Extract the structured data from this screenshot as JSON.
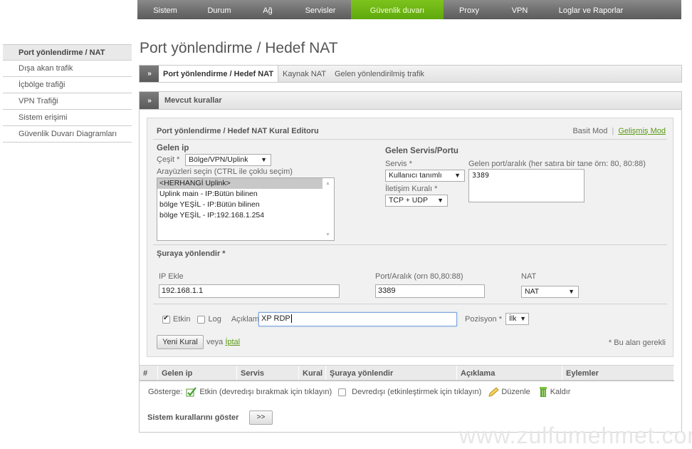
{
  "topnav": {
    "items": [
      {
        "label": "Sistem",
        "active": false
      },
      {
        "label": "Durum",
        "active": false
      },
      {
        "label": "Ağ",
        "active": false
      },
      {
        "label": "Servisler",
        "active": false
      },
      {
        "label": "Güvenlik duvarı",
        "active": true
      },
      {
        "label": "Proxy",
        "active": false
      },
      {
        "label": "VPN",
        "active": false
      },
      {
        "label": "Loglar ve Raporlar",
        "active": false
      }
    ]
  },
  "sidebar": {
    "items": [
      {
        "label": "Port yönlendirme / NAT",
        "active": true
      },
      {
        "label": "Dışa akan trafik",
        "active": false
      },
      {
        "label": "İçbölge trafiği",
        "active": false
      },
      {
        "label": "VPN Trafiği",
        "active": false
      },
      {
        "label": "Sistem erişimi",
        "active": false
      },
      {
        "label": "Güvenlik Duvarı Diagramları",
        "active": false
      }
    ]
  },
  "page": {
    "title": "Port yönlendirme / Hedef NAT",
    "chevron": "»",
    "tabs": [
      {
        "label": "Port yönlendirme / Hedef NAT",
        "active": true
      },
      {
        "label": "Kaynak NAT",
        "active": false
      },
      {
        "label": "Gelen yönlendirilmiş trafik",
        "active": false
      }
    ]
  },
  "panel": {
    "title": "Mevcut kurallar",
    "editor": {
      "title": "Port yönlendirme / Hedef NAT Kural Editoru",
      "mode_basic": "Basit Mod",
      "mode_sep": "|",
      "mode_advanced": "Gelişmiş Mod",
      "incoming_ip": {
        "section": "Gelen ip",
        "type_label": "Çeşit *",
        "type_value": "Bölge/VPN/Uplink",
        "interfaces_label": "Arayüzleri seçin (CTRL ile çoklu seçim)",
        "interfaces": [
          {
            "label": "<HERHANGİ Uplink>",
            "selected": true
          },
          {
            "label": "Uplink main - IP:Bütün bilinen",
            "selected": false
          },
          {
            "label": "bölge YEŞİL - IP:Bütün bilinen",
            "selected": false
          },
          {
            "label": "bölge YEŞİL - IP:192.168.1.254",
            "selected": false
          }
        ]
      },
      "incoming_service": {
        "section": "Gelen Servis/Portu",
        "service_label": "Servis *",
        "service_value": "Kullanıcı tanımlı",
        "protocol_label": "İletişim Kuralı *",
        "protocol_value": "TCP + UDP",
        "port_label": "Gelen port/aralık (her satıra bir tane örn: 80, 80:88)",
        "port_value": "3389"
      },
      "redirect": {
        "section": "Şuraya yönlendir *",
        "ip_label": "IP Ekle",
        "ip_value": "192.168.1.1",
        "port_label": "Port/Aralık (orn 80,80:88)",
        "port_value": "3389",
        "nat_label": "NAT",
        "nat_value": "NAT"
      },
      "enabled_label": "Etkin",
      "enabled": true,
      "log_label": "Log",
      "log": false,
      "description_label": "Açıklama",
      "description_value": "XP RDP",
      "position_label": "Pozisyon *",
      "position_value": "İlk",
      "new_rule_button": "Yeni Kural",
      "or_text": "veya",
      "cancel_link": "İptal",
      "required_note": "* Bu alan gerekli"
    },
    "table": {
      "headers": [
        "#",
        "Gelen ip",
        "Servis",
        "Kural",
        "Şuraya yönlendir",
        "Açıklama",
        "Eylemler"
      ]
    },
    "legend": {
      "label": "Gösterge:",
      "enabled": "Etkin (devredışı bırakmak için tıklayın)",
      "disabled": "Devredışı (etkinleştirmek için tıklayın)",
      "edit": "Düzenle",
      "remove": "Kaldır"
    },
    "system_rules_label": "Sistem kurallarını göster",
    "system_rules_button": ">>"
  },
  "watermark": "www.zulfumehmet.com",
  "colors": {
    "nav_active": "#6cb514",
    "link_green": "#5a9a14"
  }
}
